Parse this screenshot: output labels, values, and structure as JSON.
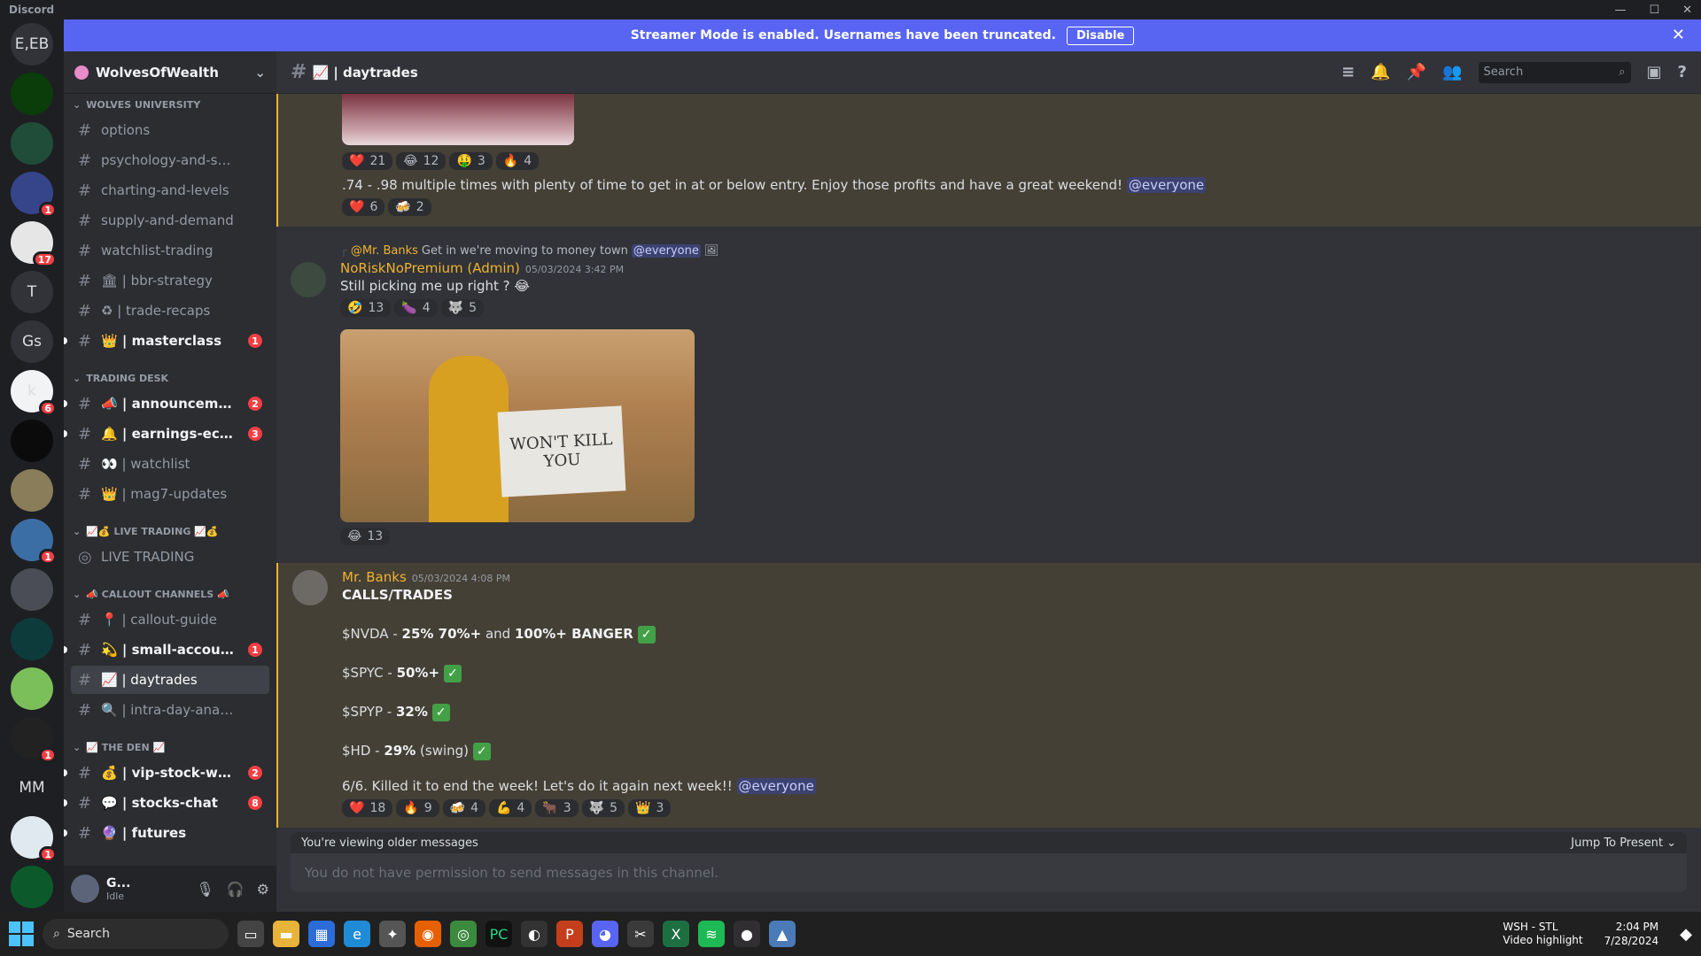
{
  "app": {
    "name": "Discord"
  },
  "banner": {
    "text": "Streamer Mode is enabled. Usernames have been truncated.",
    "disable_label": "Disable"
  },
  "servers": [
    {
      "label": "E,EB",
      "color": "#313338",
      "badge": null
    },
    {
      "label": "",
      "color": "#0a3d0a",
      "badge": null
    },
    {
      "label": "",
      "color": "#1f4d3a",
      "badge": null
    },
    {
      "label": "",
      "color": "#36458a",
      "badge": "1"
    },
    {
      "label": "",
      "color": "#e6e6e6",
      "badge": "17"
    },
    {
      "label": "T",
      "color": "#313338",
      "badge": null
    },
    {
      "label": "Gs",
      "color": "#313338",
      "badge": null
    },
    {
      "label": "k",
      "color": "#f2f3f5",
      "badge": "6"
    },
    {
      "label": "",
      "color": "#0b0b0b",
      "badge": null
    },
    {
      "label": "",
      "color": "#8a7d5a",
      "badge": null
    },
    {
      "label": "",
      "color": "#3a6ea5",
      "badge": "1"
    },
    {
      "label": "",
      "color": "#4a4d55",
      "badge": null
    },
    {
      "label": "",
      "color": "#0d3b3b",
      "badge": null
    },
    {
      "label": "",
      "color": "#7bbf5a",
      "badge": null
    },
    {
      "label": "",
      "color": "#222",
      "badge": "1"
    },
    {
      "label": "MM",
      "color": "#1e1f22",
      "badge": null
    },
    {
      "label": "",
      "color": "#e0e8f0",
      "badge": "1"
    },
    {
      "label": "",
      "color": "#0c5a2c",
      "badge": null
    }
  ],
  "guild": {
    "name": "WolvesOfWealth"
  },
  "categories": [
    {
      "name": "WOLVES UNIVERSITY",
      "channels": [
        {
          "name": "options",
          "unread": false,
          "badge": null,
          "active": false
        },
        {
          "name": "psychology-and-strategi...",
          "unread": false,
          "badge": null,
          "active": false
        },
        {
          "name": "charting-and-levels",
          "unread": false,
          "badge": null,
          "active": false
        },
        {
          "name": "supply-and-demand",
          "unread": false,
          "badge": null,
          "active": false
        },
        {
          "name": "watchlist-trading",
          "unread": false,
          "badge": null,
          "active": false
        },
        {
          "name": "🏛 | bbr-strategy",
          "unread": false,
          "badge": null,
          "active": false
        },
        {
          "name": "♻ | trade-recaps",
          "unread": false,
          "badge": null,
          "active": false
        },
        {
          "name": "👑 | masterclass",
          "unread": true,
          "badge": "1",
          "active": false
        }
      ]
    },
    {
      "name": "TRADING DESK",
      "channels": [
        {
          "name": "📣 | announcements",
          "unread": true,
          "badge": "2",
          "active": false
        },
        {
          "name": "🔔 | earnings-econo...",
          "unread": true,
          "badge": "3",
          "active": false
        },
        {
          "name": "👀 | watchlist",
          "unread": false,
          "badge": null,
          "active": false
        },
        {
          "name": "👑 | mag7-updates",
          "unread": false,
          "badge": null,
          "active": false
        }
      ]
    },
    {
      "name": "📈💰 LIVE TRADING 📈💰",
      "channels": [
        {
          "name": "LIVE TRADING",
          "unread": false,
          "badge": null,
          "active": false
        }
      ]
    },
    {
      "name": "📣 CALLOUT CHANNELS 📣",
      "channels": [
        {
          "name": "📍 | callout-guide",
          "unread": false,
          "badge": null,
          "active": false
        },
        {
          "name": "💫 | small-account-...",
          "unread": true,
          "badge": "1",
          "active": false
        },
        {
          "name": "📈 | daytrades",
          "unread": false,
          "badge": null,
          "active": true
        },
        {
          "name": "🔍 | intra-day-analysis",
          "unread": false,
          "badge": null,
          "active": false
        }
      ]
    },
    {
      "name": "📈 THE DEN 📈",
      "channels": [
        {
          "name": "💰 | vip-stock-wins",
          "unread": true,
          "badge": "2",
          "active": false
        },
        {
          "name": "💬 | stocks-chat",
          "unread": true,
          "badge": "8",
          "active": false
        },
        {
          "name": "🔮 | futures",
          "unread": true,
          "badge": null,
          "active": false
        }
      ]
    }
  ],
  "user": {
    "name": "G...",
    "status": "Idle"
  },
  "channel_header": {
    "name": "📈 | daytrades",
    "search_placeholder": "Search"
  },
  "msg1": {
    "reacts_top": [
      {
        "emoji": "❤️",
        "count": "21"
      },
      {
        "emoji": "😂",
        "count": "12"
      },
      {
        "emoji": "🤑",
        "count": "3"
      },
      {
        "emoji": "🔥",
        "count": "4"
      }
    ],
    "text": ".74 - .98 multiple times with plenty of time to get in at or below entry. Enjoy those profits and have a great weekend!",
    "mention": "@everyone",
    "reacts": [
      {
        "emoji": "❤️",
        "count": "6"
      },
      {
        "emoji": "🍻",
        "count": "2"
      }
    ]
  },
  "msg2": {
    "reply_author": "@Mr. Banks",
    "reply_text": "Get in we're moving to money town",
    "reply_mention": "@everyone",
    "author": "NoRiskNoPremium (Admin)",
    "time": "05/03/2024 3:42 PM",
    "text": "Still picking me up right ? 😂",
    "reacts": [
      {
        "emoji": "🤣",
        "count": "13"
      },
      {
        "emoji": "🍆",
        "count": "4"
      },
      {
        "emoji": "🐺",
        "count": "5"
      }
    ],
    "image_text": "WON'T KILL YOU",
    "image_reacts": [
      {
        "emoji": "😂",
        "count": "13"
      }
    ]
  },
  "msg3": {
    "author": "Mr. Banks",
    "time": "05/03/2024 4:08 PM",
    "heading": "CALLS/TRADES",
    "lines": [
      {
        "ticker": "$NVDA -",
        "bold": "25% 70%+",
        "mid": "and",
        "bold2": "100%+ BANGER"
      },
      {
        "ticker": "$SPYC -",
        "bold": "50%+",
        "mid": "",
        "bold2": ""
      },
      {
        "ticker": "$SPYP -",
        "bold": "32%",
        "mid": "",
        "bold2": ""
      },
      {
        "ticker": "$HD -",
        "bold": "29%",
        "mid": "(swing)",
        "bold2": ""
      }
    ],
    "closing": "6/6. Killed it to end the week! Let's do it again next week!!",
    "mention": "@everyone",
    "reacts": [
      {
        "emoji": "❤️",
        "count": "18"
      },
      {
        "emoji": "🔥",
        "count": "9"
      },
      {
        "emoji": "🍻",
        "count": "4"
      },
      {
        "emoji": "💪",
        "count": "4"
      },
      {
        "emoji": "🐂",
        "count": "3"
      },
      {
        "emoji": "🐺",
        "count": "5"
      },
      {
        "emoji": "👑",
        "count": "3"
      }
    ]
  },
  "older_bar": {
    "text": "You're viewing older messages",
    "jump": "Jump To Present"
  },
  "composer": {
    "placeholder": "You do not have permission to send messages in this channel."
  },
  "taskbar": {
    "search": "Search",
    "weather_title": "WSH - STL",
    "weather_sub": "Video highlight",
    "time": "2:04 PM",
    "date": "7/28/2024"
  }
}
